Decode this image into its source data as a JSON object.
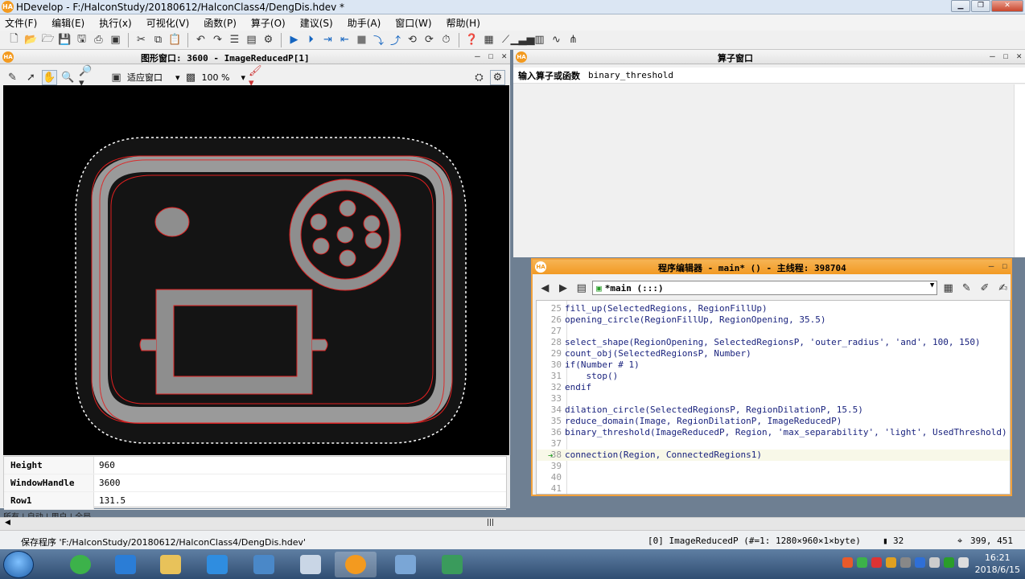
{
  "window": {
    "app_icon": "HA",
    "title": "HDevelop - F:/HalconStudy/20180612/HalconClass4/DengDis.hdev *",
    "buttons": [
      "minimize",
      "restore",
      "close"
    ]
  },
  "menu": [
    "文件(F)",
    "编辑(E)",
    "执行(x)",
    "可视化(V)",
    "函数(P)",
    "算子(O)",
    "建议(S)",
    "助手(A)",
    "窗口(W)",
    "帮助(H)"
  ],
  "graphics_window": {
    "title": "图形窗口: 3600 - ImageReducedP[1]",
    "fit_label": "适应窗口",
    "zoom": "100 %",
    "properties": [
      {
        "key": "Height",
        "value": "960"
      },
      {
        "key": "WindowHandle",
        "value": "3600"
      },
      {
        "key": "Row1",
        "value": "131.5"
      }
    ],
    "tabs": "所有 | 自动 | 用户 | 全局"
  },
  "operator_window": {
    "title": "算子窗口",
    "input_label": "输入算子或函数",
    "input_value": "binary_threshold"
  },
  "program_editor": {
    "title": "程序编辑器 - main* () - 主线程: 398704",
    "procedure": "*main (:::)",
    "lines": [
      {
        "n": "25",
        "code": "fill_up(SelectedRegions, RegionFillUp)"
      },
      {
        "n": "26",
        "code": "opening_circle(RegionFillUp, RegionOpening, 35.5)"
      },
      {
        "n": "27",
        "code": ""
      },
      {
        "n": "28",
        "code": "select_shape(RegionOpening, SelectedRegionsP, 'outer_radius', 'and', 100, 150)"
      },
      {
        "n": "29",
        "code": "count_obj(SelectedRegionsP, Number)"
      },
      {
        "n": "30",
        "code": "if(Number # 1)"
      },
      {
        "n": "31",
        "code": "    stop()"
      },
      {
        "n": "32",
        "code": "endif"
      },
      {
        "n": "33",
        "code": ""
      },
      {
        "n": "34",
        "code": "dilation_circle(SelectedRegionsP, RegionDilationP, 15.5)"
      },
      {
        "n": "35",
        "code": "reduce_domain(Image, RegionDilationP, ImageReducedP)"
      },
      {
        "n": "36",
        "code": "binary_threshold(ImageReducedP, Region, 'max_separability', 'light', UsedThreshold)"
      },
      {
        "n": "37",
        "code": ""
      },
      {
        "n": "38",
        "code": "connection(Region, ConnectedRegions1)"
      },
      {
        "n": "39",
        "code": ""
      },
      {
        "n": "40",
        "code": ""
      },
      {
        "n": "41",
        "code": ""
      }
    ]
  },
  "status": {
    "message": "保存程序 'F:/HalconStudy/20180612/HalconClass4/DengDis.hdev'",
    "image_info": "[0] ImageReducedP (#=1: 1280×960×1×byte)",
    "gray": "32",
    "coords": "399, 451"
  },
  "taskbar": {
    "time": "16:21",
    "date": "2018/6/15"
  },
  "colors": {
    "accent": "#f39a1f",
    "region_outline": "#e02020",
    "code_text": "#1a237e"
  }
}
